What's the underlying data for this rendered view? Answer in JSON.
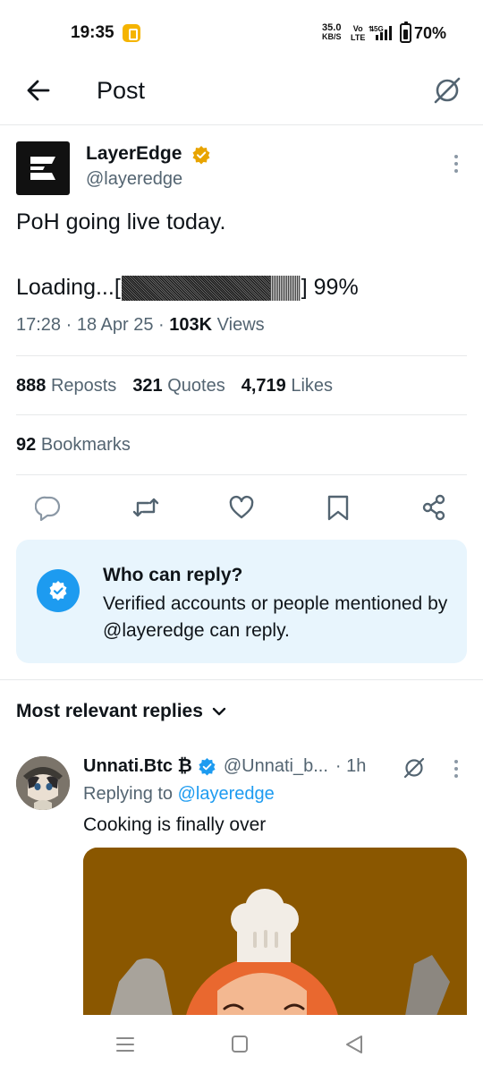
{
  "status_bar": {
    "time": "19:35",
    "net_speed": "35.0",
    "net_speed_unit": "KB/S",
    "volte_top": "Vo",
    "volte_bottom": "LTE",
    "network": "5G",
    "battery": "70%"
  },
  "header": {
    "title": "Post",
    "back_icon": "arrow-left-icon",
    "grok_icon": "grok-icon"
  },
  "tweet": {
    "author_name": "LayerEdge",
    "author_handle": "@layeredge",
    "verified_badge": "gold-verified-icon",
    "text_line1": "PoH going live today.",
    "loading_prefix": "Loading...[",
    "loading_suffix": "] 99%",
    "loading_progress": 0.83,
    "time": "17:28",
    "date": "18 Apr 25",
    "views_count": "103K",
    "views_label": "Views",
    "sep": "·"
  },
  "stats": {
    "reposts_count": "888",
    "reposts_label": "Reposts",
    "quotes_count": "321",
    "quotes_label": "Quotes",
    "likes_count": "4,719",
    "likes_label": "Likes",
    "bookmarks_count": "92",
    "bookmarks_label": "Bookmarks"
  },
  "actions": [
    "reply-icon",
    "repost-icon",
    "like-icon",
    "bookmark-icon",
    "share-icon"
  ],
  "reply_restriction": {
    "title": "Who can reply?",
    "description": "Verified accounts or people mentioned by @layeredge can reply."
  },
  "replies_section": {
    "sort_label": "Most relevant replies"
  },
  "reply": {
    "author_name": "Unnati.Btc ₿",
    "author_handle": "@Unnati_b...",
    "time": "· 1h",
    "replying_prefix": "Replying to",
    "replying_handle": "@layeredge",
    "text": "Cooking is finally over"
  },
  "colors": {
    "accent": "#1d9bf0",
    "secondary_text": "#536471",
    "reply_box_bg": "#e8f5fd",
    "gold": "#e8a400",
    "media_bg": "#8a5700"
  },
  "nav_bar": [
    "menu-icon",
    "home-icon",
    "back-icon"
  ]
}
